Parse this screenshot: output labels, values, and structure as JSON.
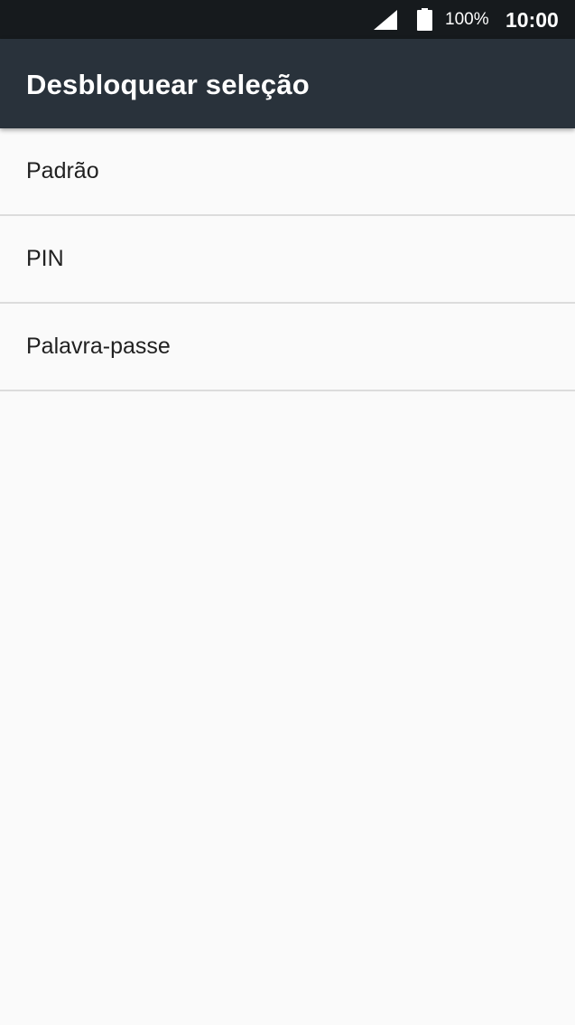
{
  "status_bar": {
    "battery_level": "100%",
    "time": "10:00",
    "icons": [
      "signal-icon",
      "battery-icon"
    ]
  },
  "app_bar": {
    "title": "Desbloquear seleção"
  },
  "options": [
    {
      "label": "Padrão"
    },
    {
      "label": "PIN"
    },
    {
      "label": "Palavra-passe"
    }
  ],
  "colors": {
    "status_bar_bg": "#161a1d",
    "app_bar_bg": "#29323b",
    "background": "#fafafa",
    "divider": "#dcdcdc",
    "text_primary": "#212121"
  }
}
